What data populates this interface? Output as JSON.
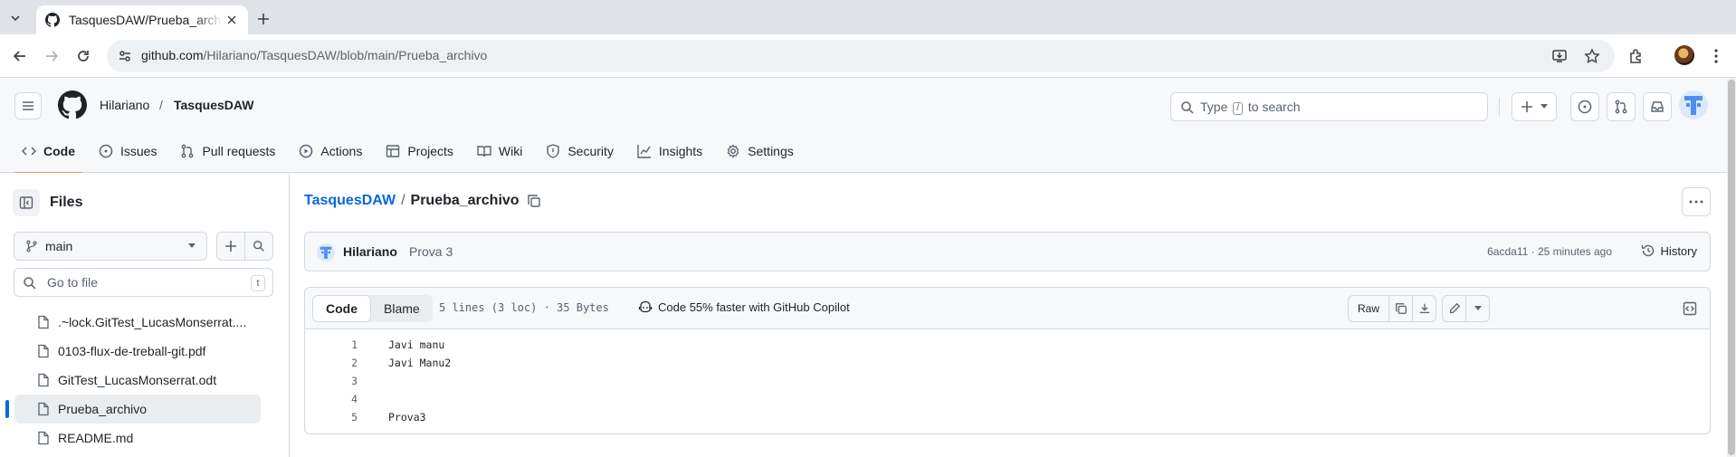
{
  "browser": {
    "tab_title": "TasquesDAW/Prueba_archivo",
    "url_host": "github.com",
    "url_path": "/Hilariano/TasquesDAW/blob/main/Prueba_archivo"
  },
  "header": {
    "owner": "Hilariano",
    "separator": "/",
    "repo": "TasquesDAW",
    "search_prefix": "Type",
    "search_key": "/",
    "search_suffix": "to search"
  },
  "repo_nav": [
    {
      "label": "Code",
      "icon": "code-icon",
      "active": true
    },
    {
      "label": "Issues",
      "icon": "issue-icon"
    },
    {
      "label": "Pull requests",
      "icon": "pull-request-icon"
    },
    {
      "label": "Actions",
      "icon": "play-icon"
    },
    {
      "label": "Projects",
      "icon": "table-icon"
    },
    {
      "label": "Wiki",
      "icon": "book-icon"
    },
    {
      "label": "Security",
      "icon": "shield-icon"
    },
    {
      "label": "Insights",
      "icon": "graph-icon"
    },
    {
      "label": "Settings",
      "icon": "gear-icon"
    }
  ],
  "sidebar": {
    "title": "Files",
    "branch": "main",
    "goto_placeholder": "Go to file",
    "goto_key": "t",
    "files": [
      {
        "name": ".~lock.GitTest_LucasMonserrat...."
      },
      {
        "name": "0103-flux-de-treball-git.pdf"
      },
      {
        "name": "GitTest_LucasMonserrat.odt"
      },
      {
        "name": "Prueba_archivo",
        "selected": true
      },
      {
        "name": "README.md"
      }
    ]
  },
  "main": {
    "path_repo": "TasquesDAW",
    "path_sep": "/",
    "path_file": "Prueba_archivo",
    "commit": {
      "author": "Hilariano",
      "message": "Prova 3",
      "meta": "6acda11 · 25 minutes ago",
      "history_label": "History"
    },
    "file": {
      "tab_code": "Code",
      "tab_blame": "Blame",
      "info": "5 lines (3 loc) · 35 Bytes",
      "copilot": "Code 55% faster with GitHub Copilot",
      "raw_label": "Raw",
      "lines": [
        {
          "n": "1",
          "text": "Javi manu"
        },
        {
          "n": "2",
          "text": "Javi Manu2"
        },
        {
          "n": "3",
          "text": ""
        },
        {
          "n": "4",
          "text": ""
        },
        {
          "n": "5",
          "text": "Prova3"
        }
      ]
    }
  }
}
